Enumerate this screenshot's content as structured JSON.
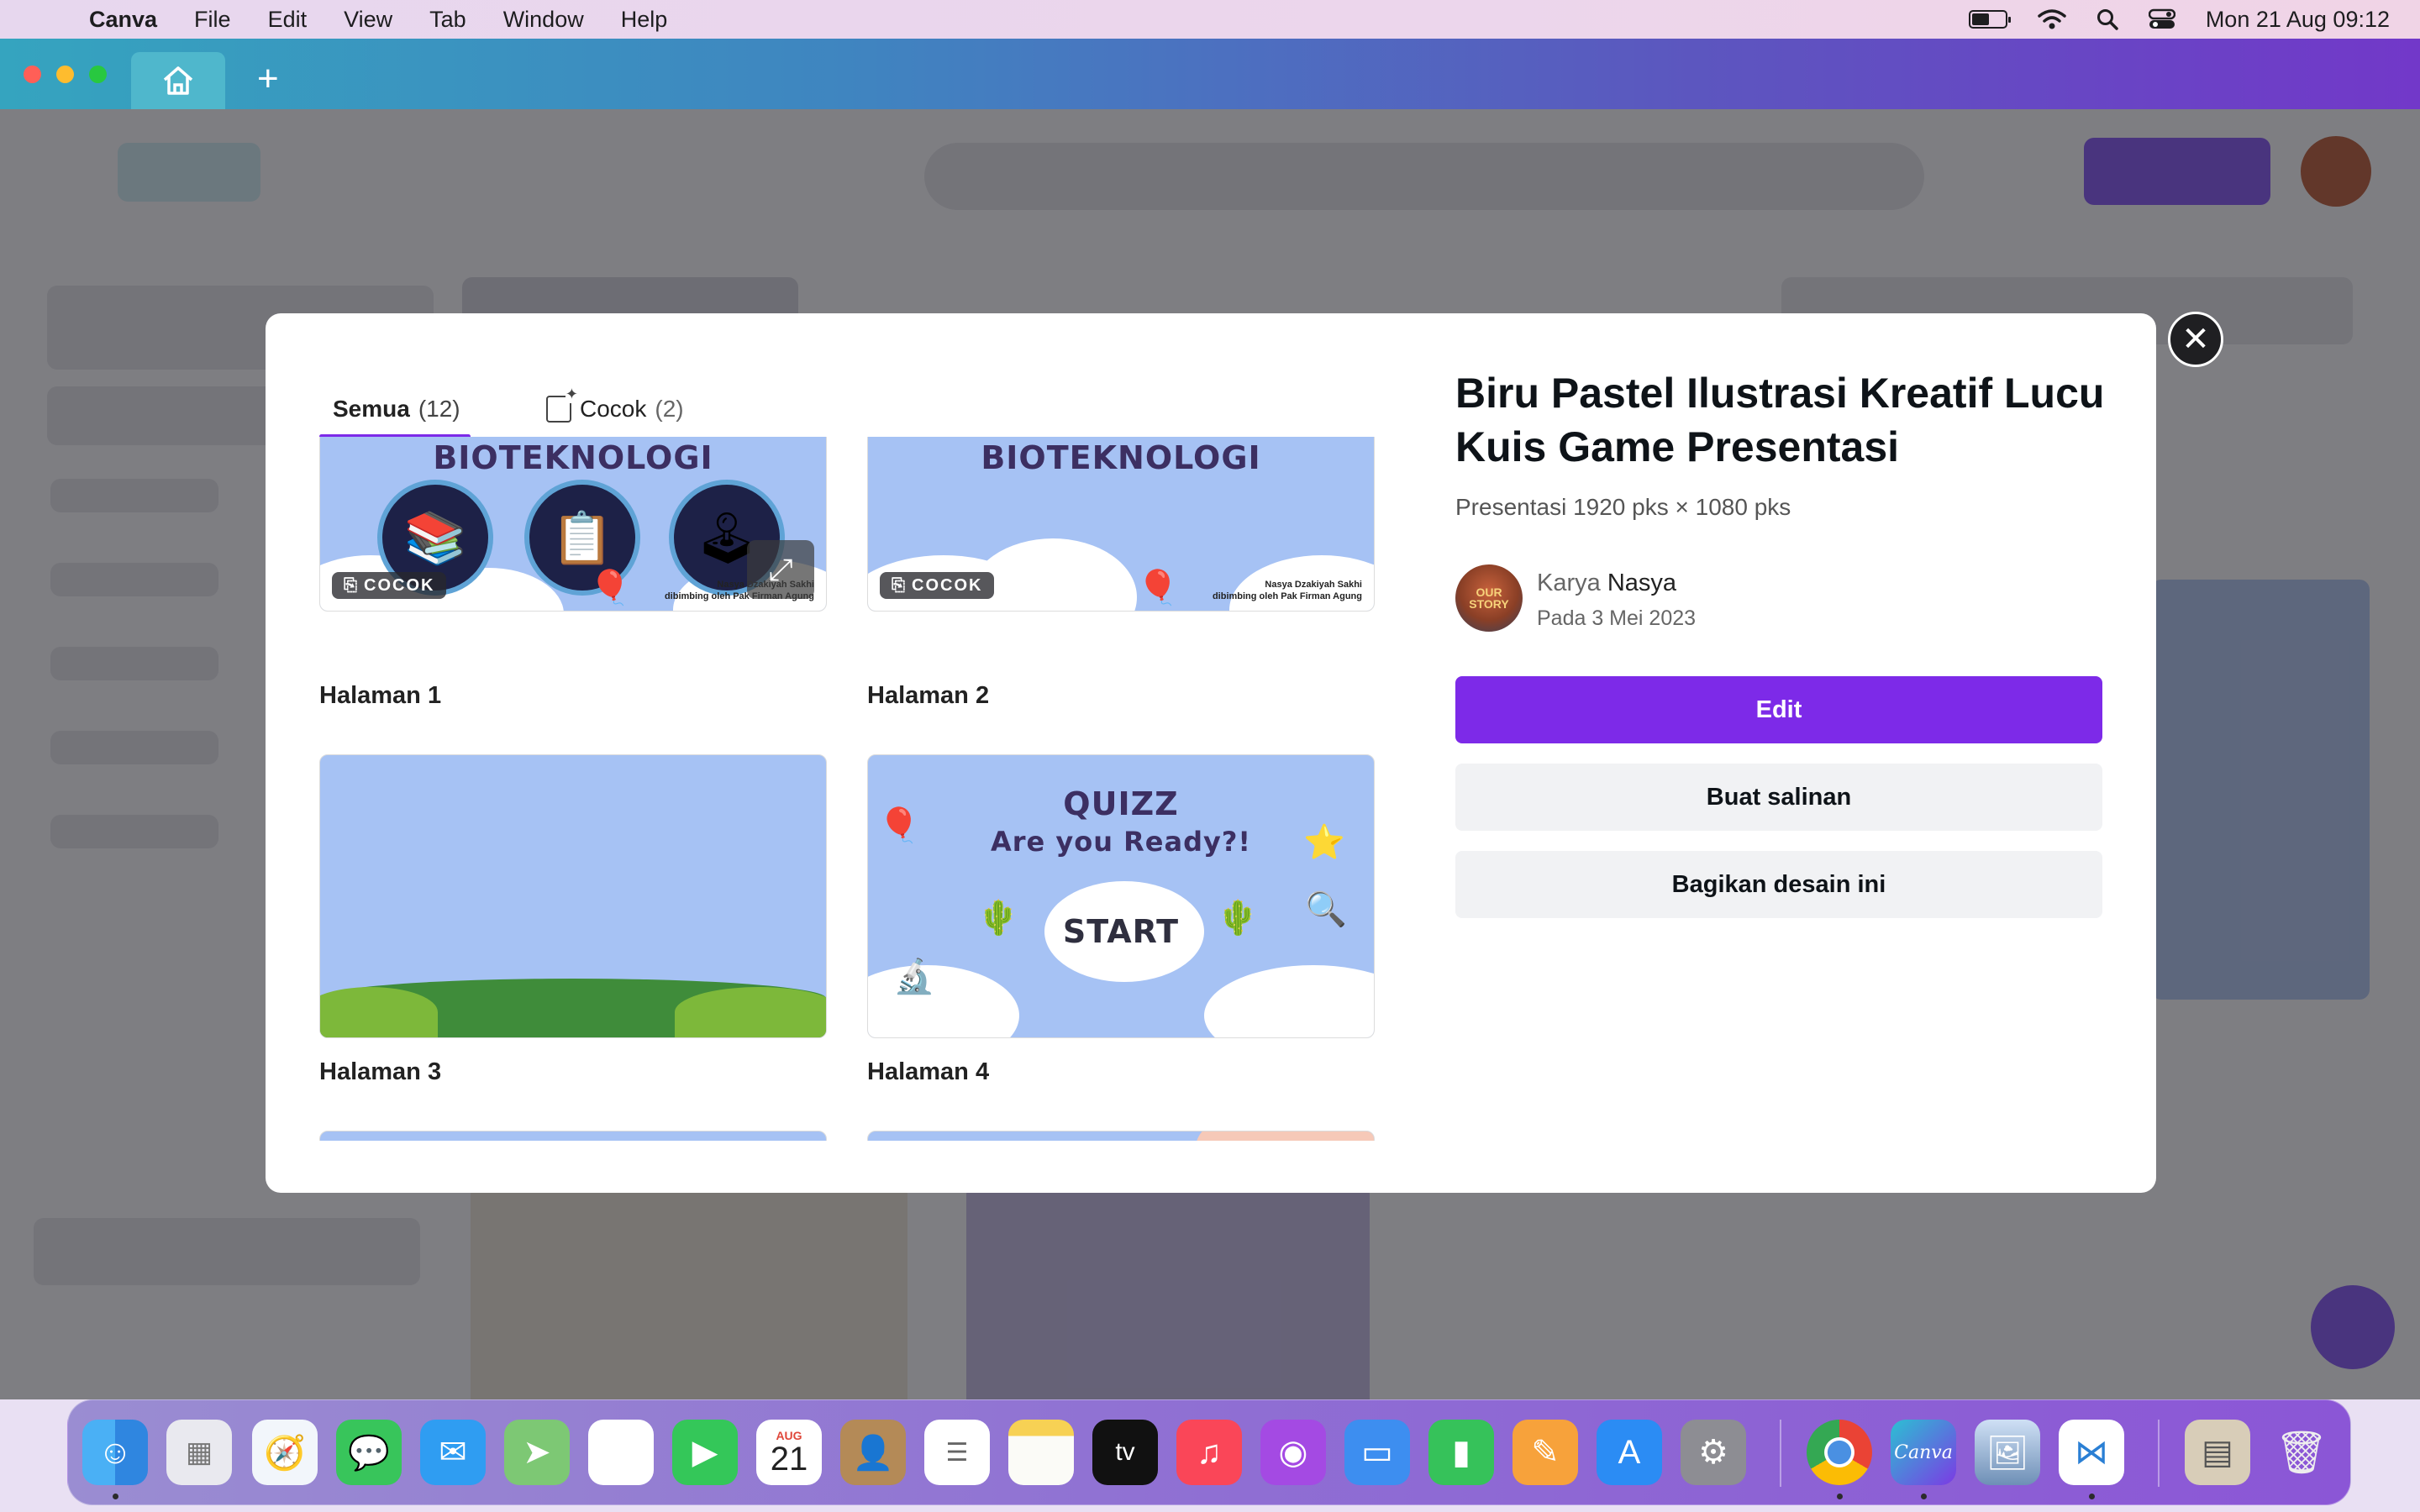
{
  "menubar": {
    "app_name": "Canva",
    "items": [
      "File",
      "Edit",
      "View",
      "Tab",
      "Window",
      "Help"
    ],
    "datetime": "Mon 21 Aug  09:12"
  },
  "modal": {
    "tabs": [
      {
        "label": "Semua",
        "count": "(12)"
      },
      {
        "label": "Cocok",
        "count": "(2)"
      }
    ],
    "pages": [
      {
        "label": "Halaman 1",
        "badge": "COCOK",
        "title": "BIOTEKNOLOGI",
        "credit": "Nasya Dzakiyah Sakhi\ndibimbing oleh Pak Firman Agung"
      },
      {
        "label": "Halaman 2",
        "badge": "COCOK",
        "title": "BIOTEKNOLOGI",
        "credit": "Nasya Dzakiyah Sakhi\ndibimbing oleh Pak Firman Agung"
      },
      {
        "label": "Halaman 3"
      },
      {
        "label": "Halaman 4",
        "title": "QUIZZ",
        "subtitle": "Are you Ready?!",
        "start": "START"
      }
    ],
    "design_title": "Biru Pastel Ilustrasi Kreatif Lucu Kuis Game Presentasi",
    "design_meta": "Presentasi 1920 pks × 1080 pks",
    "author_prefix": "Karya",
    "author_name": "Nasya",
    "author_date": "Pada 3 Mei 2023",
    "avatar_text": "OUR STORY",
    "buttons": {
      "edit": "Edit",
      "copy": "Buat salinan",
      "share": "Bagikan desain ini"
    }
  },
  "dock": {
    "calendar_month": "AUG",
    "calendar_day": "21",
    "tv_label": "tv",
    "canva_label": "Canva",
    "apps": [
      "finder",
      "launchpad",
      "safari",
      "messages",
      "mail",
      "maps",
      "photos",
      "facetime",
      "calendar",
      "contacts",
      "reminders",
      "notes",
      "apple-tv",
      "music",
      "podcasts",
      "keynote",
      "numbers",
      "pages",
      "app-store",
      "system-settings",
      "chrome",
      "canva",
      "preview",
      "vscode",
      "downloads",
      "trash"
    ]
  },
  "colors": {
    "accent": "#7d2ae8",
    "slide_bg": "#a6c2f4",
    "title_ink": "#3c2f62"
  }
}
